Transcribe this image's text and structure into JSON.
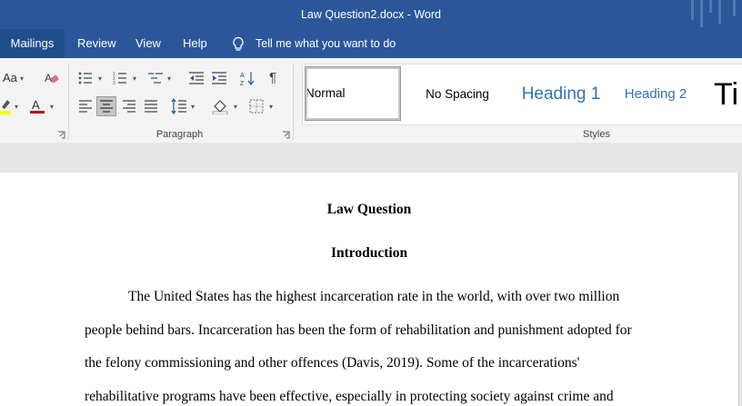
{
  "window": {
    "title": "Law Question2.docx  -  Word"
  },
  "tabs": [
    {
      "label": "Mailings",
      "active": true
    },
    {
      "label": "Review"
    },
    {
      "label": "View"
    },
    {
      "label": "Help"
    }
  ],
  "tell_me": {
    "label": "Tell me what you want to do"
  },
  "ribbon": {
    "font_group": {
      "change_case_label": "Aa"
    },
    "paragraph_group": {
      "label": "Paragraph"
    },
    "styles_group": {
      "label": "Styles",
      "items": [
        "Normal",
        "No Spacing",
        "Heading 1",
        "Heading 2",
        "Ti"
      ],
      "selected": "Normal"
    },
    "icons": {
      "font_color": "#c00000",
      "highlight_color": "#ffff00",
      "accent": "#2b579a"
    }
  },
  "document": {
    "title": "Law Question",
    "heading": "Introduction",
    "lines": [
      "The United States has the highest incarceration rate in the world, with over two million",
      "people behind bars. Incarceration has been the form of rehabilitation and punishment adopted for",
      "the felony commissioning and other offences (Davis, 2019). Some of the incarcerations'",
      "rehabilitative programs have been effective, especially in protecting society against crime and"
    ]
  }
}
